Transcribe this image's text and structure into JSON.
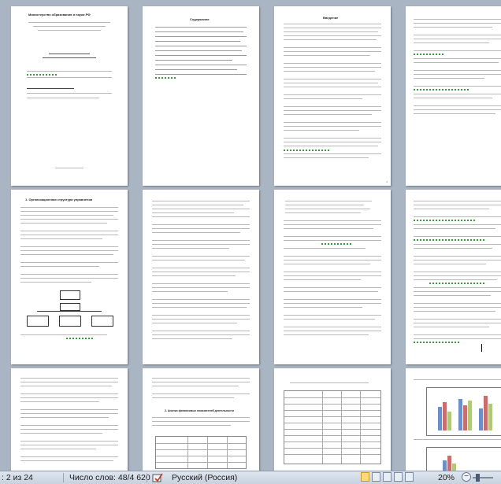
{
  "app": {
    "name": "Microsoft Word",
    "view": "multi-page thumbnail view"
  },
  "pages": [
    {
      "title": "Министерство образования и науки РФ"
    },
    {
      "title": "Содержание"
    },
    {
      "title": "Введение"
    },
    {
      "title": ""
    },
    {
      "title": "1. Организационная структура управления"
    },
    {
      "title": ""
    },
    {
      "title": ""
    },
    {
      "title": ""
    },
    {
      "title": ""
    },
    {
      "title": "2. Анализ финансовых показателей деятельности"
    },
    {
      "title": ""
    },
    {
      "title": ""
    }
  ],
  "statusbar": {
    "page_indicator": ": 2 из 24",
    "word_count": "Число слов: 48/4 620",
    "language": "Русский (Россия)",
    "zoom_level": "20%",
    "zoom_fraction": 0.2,
    "zoom_out": "−",
    "zoom_in": "+"
  },
  "colors": {
    "workspace": "#a9b5c3",
    "page": "#ffffff",
    "grammar_underline": "#3a9a3a",
    "statusbar": "#d3dce7"
  }
}
